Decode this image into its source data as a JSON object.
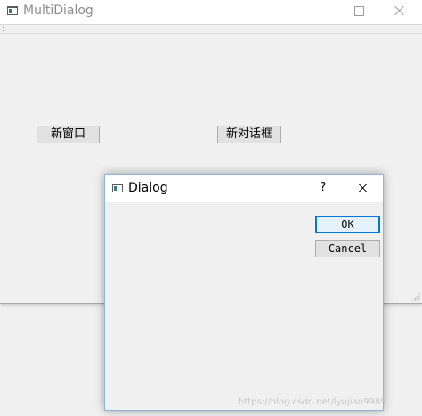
{
  "main_window": {
    "title": "MultiDialog",
    "new_window_label": "新窗口",
    "new_dialog_label": "新对话框"
  },
  "dialog": {
    "title": "Dialog",
    "help_label": "?",
    "ok_label": "OK",
    "cancel_label": "Cancel"
  },
  "watermark": {
    "text": "https://blog.csdn.net/lyujian9985"
  },
  "icons": {
    "app": "app-window-icon",
    "minimize": "minimize-icon",
    "maximize": "maximize-icon",
    "close": "close-icon"
  },
  "colors": {
    "focus_accent": "#0078d7",
    "window_bg": "#f0f0f0",
    "titlebar_bg": "#ffffff",
    "inactive_title": "#8c8c8c"
  }
}
